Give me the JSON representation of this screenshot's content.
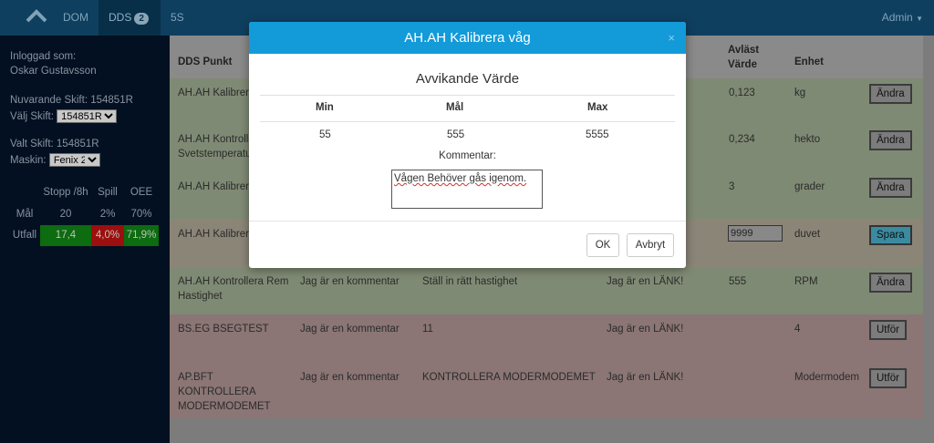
{
  "nav": {
    "dom": "DOM",
    "dds": "DDS",
    "dds_badge": "2",
    "five_s": "5S",
    "admin": "Admin"
  },
  "sidebar": {
    "logged_in_label": "Inloggad som:",
    "user_name": "Oskar Gustavsson",
    "current_shift": "Nuvarande Skift: 154851R",
    "choose_shift_label": "Välj Skift:",
    "shift_select_value": "154851R",
    "selected_shift": "Valt Skift: 154851R",
    "machine_label": "Maskin:",
    "machine_select_value": "Fenix 2",
    "stats": {
      "headers": [
        "Stopp /8h",
        "Spill",
        "OEE"
      ],
      "goal_label": "Mål",
      "goal": [
        "20",
        "2%",
        "70%"
      ],
      "outcome_label": "Utfall",
      "outcome": [
        "17,4",
        "4,0%",
        "71,9%"
      ],
      "outcome_colors": [
        "#0d6b10",
        "#9c0f0f",
        "#0d6b10"
      ]
    }
  },
  "table": {
    "headers": {
      "dds_punkt": "DDS Punkt",
      "avlast_varde": "Avläst Värde",
      "enhet": "Enhet"
    },
    "rows": [
      {
        "punkt": "AH.AH Kalibrera våg",
        "kommentar": "",
        "atgard": "",
        "lank": "",
        "varde": "0,123",
        "enhet": "kg",
        "button": "Ändra",
        "bg": "#7f8a74"
      },
      {
        "punkt": "AH.AH Kontrollera Svetstemperatur",
        "kommentar": "",
        "atgard": "",
        "lank": "",
        "varde": "0,234",
        "enhet": "hekto",
        "button": "Ändra",
        "bg": "#7f8a74"
      },
      {
        "punkt": "AH.AH Kalibrera",
        "kommentar": "",
        "atgard": "",
        "lank": "",
        "varde": "3",
        "enhet": "grader",
        "button": "Ändra",
        "bg": "#7f8a74"
      },
      {
        "punkt": "AH.AH Kalibrera",
        "kommentar": "",
        "atgard": "",
        "lank": "",
        "varde": "9999",
        "enhet": "duvet",
        "button": "Spara",
        "bg": "#8b8578"
      },
      {
        "punkt": "AH.AH Kontrollera Rem Hastighet",
        "kommentar": "Jag är en kommentar",
        "atgard": "Ställ in rätt hastighet",
        "lank": "Jag är en LÄNK!",
        "varde": "555",
        "enhet": "RPM",
        "button": "Ändra",
        "bg": "#7f8a74"
      },
      {
        "punkt": "BS.EG BSEGTEST",
        "kommentar": "Jag är en kommentar",
        "atgard": "11",
        "lank": "Jag är en LÄNK!",
        "varde": "",
        "enhet": "4",
        "button": "Utför",
        "bg": "#8b7575"
      },
      {
        "punkt": "AP.BFT KONTROLLERA MODERMODEMET",
        "kommentar": "Jag är en kommentar",
        "atgard": "KONTROLLERA MODERMODEMET",
        "lank": "Jag är en LÄNK!",
        "varde": "",
        "enhet": "Modermodem",
        "button": "Utför",
        "bg": "#8b7575"
      }
    ]
  },
  "modal": {
    "title": "AH.AH Kalibrera våg",
    "close": "×",
    "subtitle": "Avvikande Värde",
    "headers": [
      "Min",
      "Mål",
      "Max"
    ],
    "values": [
      "55",
      "555",
      "5555"
    ],
    "comment_label": "Kommentar:",
    "comment_value": "Vågen Behöver gås igenom.",
    "ok_label": "OK",
    "cancel_label": "Avbryt"
  }
}
